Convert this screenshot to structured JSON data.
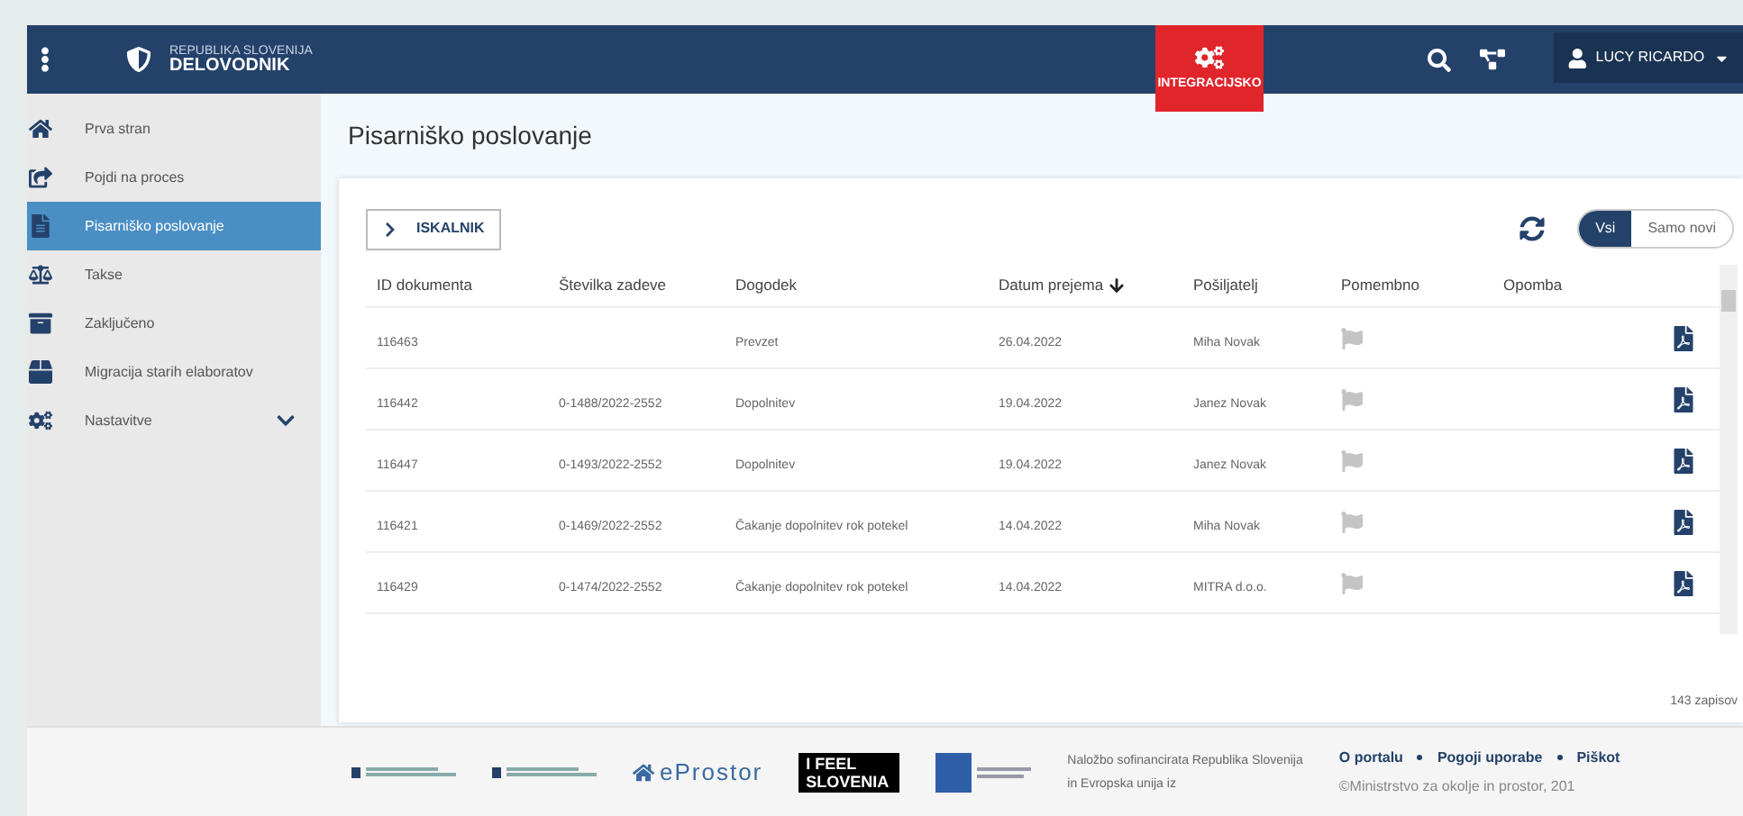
{
  "header": {
    "org": "REPUBLIKA SLOVENIJA",
    "app": "DELOVODNIK",
    "badge": "INTEGRACIJSKO",
    "user": "LUCY RICARDO"
  },
  "sidebar": {
    "items": [
      {
        "label": "Prva stran",
        "kind": "home",
        "selected": false
      },
      {
        "label": "Pojdi na proces",
        "kind": "share",
        "selected": false
      },
      {
        "label": "Pisarniško poslovanje",
        "kind": "file",
        "selected": true
      },
      {
        "label": "Takse",
        "kind": "scale",
        "selected": false
      },
      {
        "label": "Zaključeno",
        "kind": "archive",
        "selected": false
      },
      {
        "label": "Migracija starih elaboratov",
        "kind": "box",
        "selected": false
      },
      {
        "label": "Nastavitve",
        "kind": "gears",
        "selected": false,
        "expanded": false
      }
    ]
  },
  "page": {
    "title": "Pisarniško poslovanje"
  },
  "toolbar": {
    "search_button": "ISKALNIK",
    "filters": [
      {
        "label": "Vsi",
        "selected": true
      },
      {
        "label": "Samo novi",
        "selected": false
      }
    ]
  },
  "table": {
    "columns": [
      "ID dokumenta",
      "Številka zadeve",
      "Dogodek",
      "Datum prejema",
      "Pošiljatelj",
      "Pomembno",
      "Opomba"
    ],
    "rows": [
      {
        "id": "116463",
        "case": "",
        "event": "Prevzet",
        "date": "26.04.2022",
        "sender": "Miha Novak",
        "important": false
      },
      {
        "id": "116442",
        "case": "0-1488/2022-2552",
        "event": "Dopolnitev",
        "date": "19.04.2022",
        "sender": "Janez Novak",
        "important": false
      },
      {
        "id": "116447",
        "case": "0-1493/2022-2552",
        "event": "Dopolnitev",
        "date": "19.04.2022",
        "sender": "Janez Novak",
        "important": false
      },
      {
        "id": "116421",
        "case": "0-1469/2022-2552",
        "event": "Čakanje dopolnitev rok potekel",
        "date": "14.04.2022",
        "sender": "Miha Novak",
        "important": false
      },
      {
        "id": "116429",
        "case": "0-1474/2022-2552",
        "event": "Čakanje dopolnitev rok potekel",
        "date": "14.04.2022",
        "sender": "MITRA d.o.o.",
        "important": false
      }
    ],
    "count": "143 zapisov"
  },
  "footer": {
    "logos": [
      {
        "kind": "gov"
      },
      {
        "kind": "gov"
      },
      {
        "kind": "text",
        "text": "eProstor"
      },
      {
        "kind": "feel",
        "text": "I FEEL",
        "text2": "SLOVENIA"
      },
      {
        "kind": "eu"
      }
    ],
    "note": [
      "Naložbo sofinancirata Republika Slovenija",
      "in Evropska unija iz"
    ],
    "links": [
      "O portalu",
      "Pogoji uporabe",
      "Piškot"
    ],
    "copyright": "©Ministrstvo za okolje in prostor, 201"
  }
}
